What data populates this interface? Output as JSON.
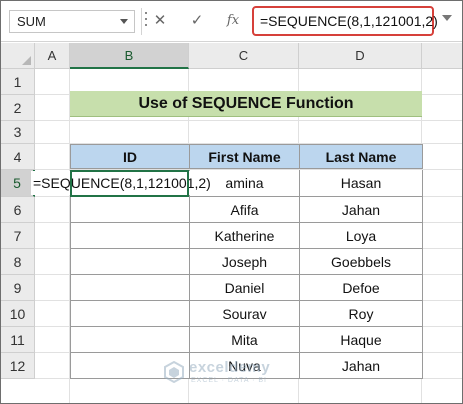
{
  "formula_bar": {
    "name_box": "SUM",
    "cancel_icon": "✕",
    "enter_icon": "✓",
    "fx_label": "fx",
    "formula": "=SEQUENCE(8,1,121001,2)"
  },
  "columns": [
    "A",
    "B",
    "C",
    "D"
  ],
  "rows": [
    "1",
    "2",
    "3",
    "4",
    "5",
    "6",
    "7",
    "8",
    "9",
    "10",
    "11",
    "12"
  ],
  "active_cell": {
    "column": "B",
    "row": "5"
  },
  "sheet": {
    "title": "Use of SEQUENCE Function",
    "headers": [
      "ID",
      "First Name",
      "Last Name"
    ],
    "edit_text": "=SEQUENCE(8,1,121001,2)",
    "records": [
      {
        "first": "amina",
        "last": "Hasan"
      },
      {
        "first": "Afifa",
        "last": "Jahan"
      },
      {
        "first": "Katherine",
        "last": "Loya"
      },
      {
        "first": "Joseph",
        "last": "Goebbels"
      },
      {
        "first": "Daniel",
        "last": "Defoe"
      },
      {
        "first": "Sourav",
        "last": "Roy"
      },
      {
        "first": "Mita",
        "last": "Haque"
      },
      {
        "first": "Nuva",
        "last": "Jahan"
      }
    ]
  },
  "watermark": {
    "name": "exceldemy",
    "tagline": "EXCEL · DATA · BI"
  },
  "colors": {
    "accent": "#217346",
    "title_fill": "#c7dfac",
    "header_fill": "#bcd6ee",
    "highlight_border": "#d6403a"
  }
}
